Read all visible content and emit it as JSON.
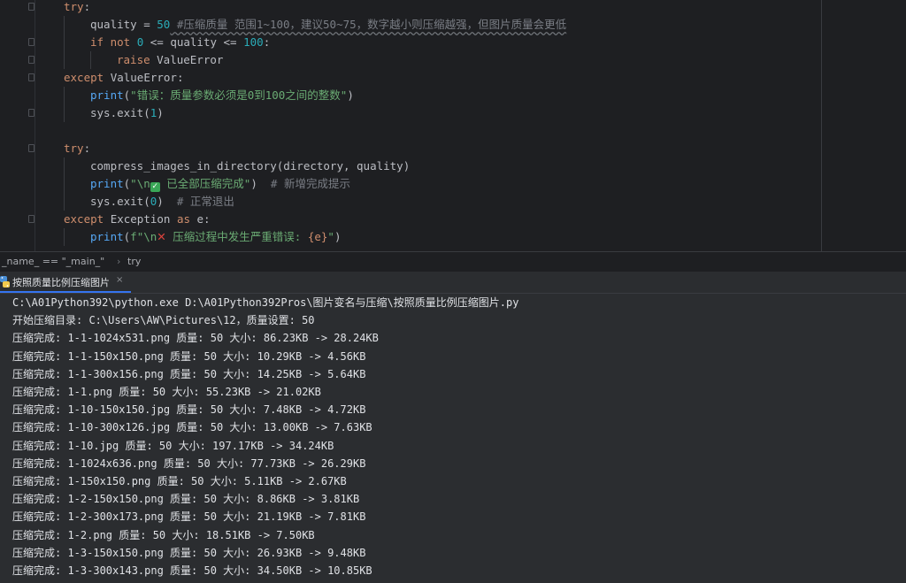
{
  "editor": {
    "lines": [
      {
        "segments": [
          {
            "t": "try",
            "c": "kw"
          },
          {
            "t": ":",
            "c": ""
          }
        ]
      },
      {
        "segments": [
          {
            "t": "quality",
            "c": ""
          },
          {
            "t": " = ",
            "c": ""
          },
          {
            "t": "50",
            "c": "num"
          },
          {
            "t": " #压缩质量 范围1~100，建议50~75，数字越小则压缩越强，但图片质量会更低",
            "c": "cm wavy"
          }
        ]
      },
      {
        "segments": [
          {
            "t": "if not ",
            "c": "kw"
          },
          {
            "t": "0",
            "c": "num"
          },
          {
            "t": " <= quality <= ",
            "c": ""
          },
          {
            "t": "100",
            "c": "num"
          },
          {
            "t": ":",
            "c": ""
          }
        ]
      },
      {
        "segments": [
          {
            "t": "raise ",
            "c": "kw"
          },
          {
            "t": "ValueError",
            "c": "cls"
          }
        ]
      },
      {
        "segments": [
          {
            "t": "except ",
            "c": "kw"
          },
          {
            "t": "ValueError",
            "c": "cls"
          },
          {
            "t": ":",
            "c": ""
          }
        ]
      },
      {
        "segments": [
          {
            "t": "print",
            "c": "fn"
          },
          {
            "t": "(",
            "c": ""
          },
          {
            "t": "\"错误：质量参数必须是0到100之间的整数\"",
            "c": "str"
          },
          {
            "t": ")",
            "c": ""
          }
        ]
      },
      {
        "segments": [
          {
            "t": "sys.exit(",
            "c": ""
          },
          {
            "t": "1",
            "c": "num"
          },
          {
            "t": ")",
            "c": ""
          }
        ]
      },
      {
        "segments": []
      },
      {
        "segments": [
          {
            "t": "try",
            "c": "kw"
          },
          {
            "t": ":",
            "c": ""
          }
        ]
      },
      {
        "segments": [
          {
            "t": "compress_images_in_directory(directory, quality)",
            "c": ""
          }
        ]
      },
      {
        "segments": [
          {
            "t": "print",
            "c": "fn"
          },
          {
            "t": "(",
            "c": ""
          },
          {
            "t": "\"\\n",
            "c": "str"
          },
          {
            "t": "✓",
            "c": "chk"
          },
          {
            "t": " 已全部压缩完成\"",
            "c": "str"
          },
          {
            "t": ")",
            "c": ""
          },
          {
            "t": "  # 新增完成提示",
            "c": "cm"
          }
        ]
      },
      {
        "segments": [
          {
            "t": "sys.exit(",
            "c": ""
          },
          {
            "t": "0",
            "c": "num"
          },
          {
            "t": ")",
            "c": ""
          },
          {
            "t": "  # 正常退出",
            "c": "cm"
          }
        ]
      },
      {
        "segments": [
          {
            "t": "except ",
            "c": "kw"
          },
          {
            "t": "Exception",
            "c": "cls"
          },
          {
            "t": " as ",
            "c": "kw"
          },
          {
            "t": "e:",
            "c": ""
          }
        ]
      },
      {
        "segments": [
          {
            "t": "print",
            "c": "fn"
          },
          {
            "t": "(",
            "c": ""
          },
          {
            "t": "f\"\\n",
            "c": "str"
          },
          {
            "t": "✕",
            "c": "xmark"
          },
          {
            "t": " 压缩过程中发生严重错误: ",
            "c": "str"
          },
          {
            "t": "{e}",
            "c": "kw"
          },
          {
            "t": "\"",
            "c": "str"
          },
          {
            "t": ")",
            "c": ""
          }
        ]
      }
    ]
  },
  "breadcrumb": {
    "item1": "_name_ == \"_main_\"",
    "separator": "›",
    "item2": "try"
  },
  "run": {
    "tab_label": "按照质量比例压缩图片",
    "close_label": "×",
    "console_lines": [
      "C:\\A01Python392\\python.exe D:\\A01Python392Pros\\图片变名与压缩\\按照质量比例压缩图片.py",
      "开始压缩目录: C:\\Users\\AW\\Pictures\\12，质量设置: 50",
      "压缩完成: 1-1-1024x531.png 质量: 50 大小: 86.23KB -> 28.24KB",
      "压缩完成: 1-1-150x150.png 质量: 50 大小: 10.29KB -> 4.56KB",
      "压缩完成: 1-1-300x156.png 质量: 50 大小: 14.25KB -> 5.64KB",
      "压缩完成: 1-1.png 质量: 50 大小: 55.23KB -> 21.02KB",
      "压缩完成: 1-10-150x150.jpg 质量: 50 大小: 7.48KB -> 4.72KB",
      "压缩完成: 1-10-300x126.jpg 质量: 50 大小: 13.00KB -> 7.63KB",
      "压缩完成: 1-10.jpg 质量: 50 大小: 197.17KB -> 34.24KB",
      "压缩完成: 1-1024x636.png 质量: 50 大小: 77.73KB -> 26.29KB",
      "压缩完成: 1-150x150.png 质量: 50 大小: 5.11KB -> 2.67KB",
      "压缩完成: 1-2-150x150.png 质量: 50 大小: 8.86KB -> 3.81KB",
      "压缩完成: 1-2-300x173.png 质量: 50 大小: 21.19KB -> 7.81KB",
      "压缩完成: 1-2.png 质量: 50 大小: 18.51KB -> 7.50KB",
      "压缩完成: 1-3-150x150.png 质量: 50 大小: 26.93KB -> 9.48KB",
      "压缩完成: 1-3-300x143.png 质量: 50 大小: 34.50KB -> 10.85KB"
    ]
  },
  "colors": {
    "editor_bg": "#1e1f22",
    "panel_bg": "#2b2d30",
    "keyword": "#cf8e6d",
    "number": "#2aacb8",
    "string": "#6aab73",
    "comment": "#7a7e85",
    "function": "#56a8f5",
    "tab_accent": "#3574f0"
  }
}
